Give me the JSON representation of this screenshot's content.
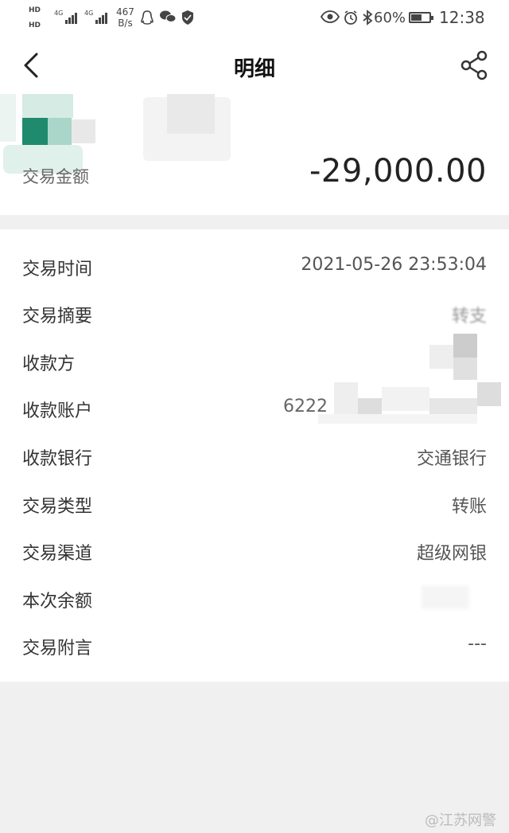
{
  "status_bar": {
    "hd1": "HD",
    "hd2": "HD",
    "sig1": "4G",
    "sig2": "4G",
    "net_speed_value": "467",
    "net_speed_unit": "B/s",
    "battery_percent": 60,
    "battery_label": "60%",
    "time": "12:38"
  },
  "nav": {
    "title": "明细"
  },
  "summary": {
    "amount_label": "交易金额",
    "amount": "-29,000.00"
  },
  "details": [
    {
      "label": "交易时间",
      "value": "2021-05-26 23:53:04"
    },
    {
      "label": "交易摘要",
      "value": "转支"
    },
    {
      "label": "收款方",
      "value": ""
    },
    {
      "label": "收款账户",
      "value": "6222"
    },
    {
      "label": "收款银行",
      "value": "交通银行"
    },
    {
      "label": "交易类型",
      "value": "转账"
    },
    {
      "label": "交易渠道",
      "value": "超级网银"
    },
    {
      "label": "本次余额",
      "value": ""
    },
    {
      "label": "交易附言",
      "value": "---"
    }
  ],
  "watermark": "@江苏网警",
  "colors": {
    "background": "#f0f0f0",
    "card": "#ffffff",
    "text_primary": "#222222",
    "text_secondary": "#555555",
    "blur_green": "#1f8a6e"
  },
  "icons": {
    "back": "chevron-left-icon",
    "share": "share-icon"
  }
}
